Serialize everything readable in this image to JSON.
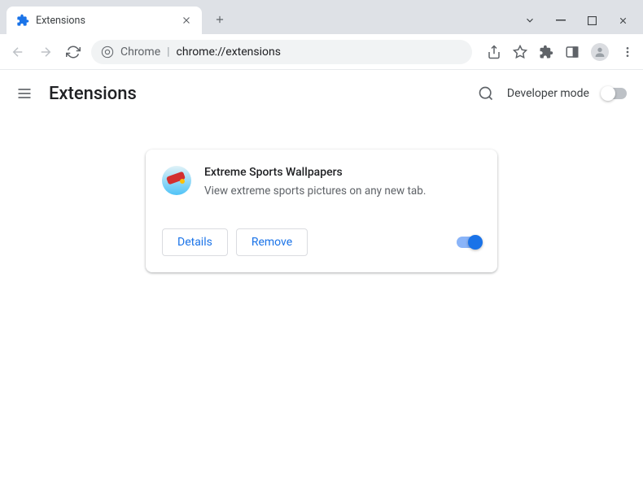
{
  "titlebar": {
    "tab_title": "Extensions"
  },
  "omnibox": {
    "prefix": "Chrome",
    "url_display": "chrome://extensions"
  },
  "header": {
    "title": "Extensions",
    "developer_mode_label": "Developer mode",
    "developer_mode_on": false
  },
  "extension": {
    "name": "Extreme Sports Wallpapers",
    "description": "View extreme sports pictures on any new tab.",
    "details_button": "Details",
    "remove_button": "Remove",
    "enabled": true
  }
}
